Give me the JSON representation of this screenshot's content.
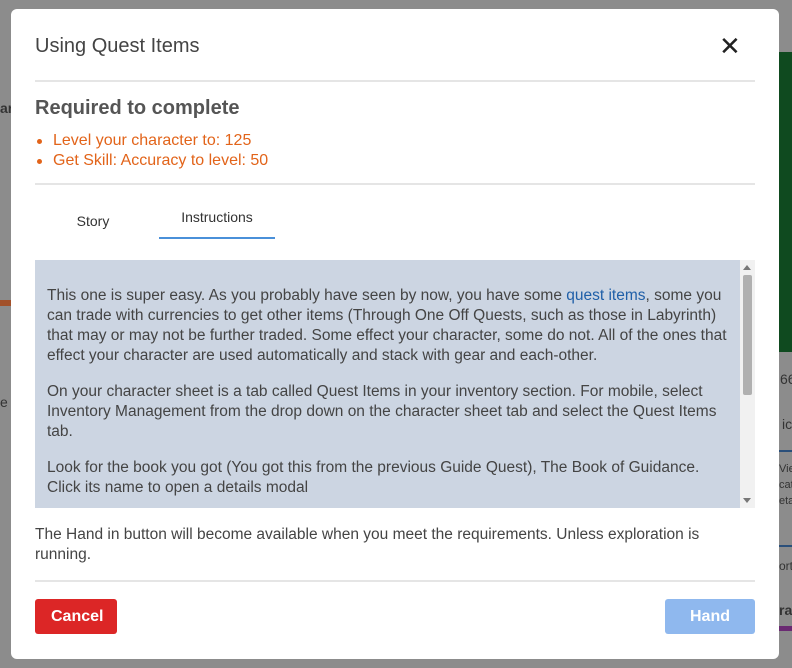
{
  "background": {
    "fragments": [
      "ar",
      "e",
      "66",
      "ict",
      "View",
      "cat",
      "eta",
      "ort",
      "ra"
    ]
  },
  "modal": {
    "title": "Using Quest Items",
    "close_icon": "close-icon"
  },
  "requirements": {
    "heading": "Required to complete",
    "items": [
      "Level your character to: 125",
      "Get Skill: Accuracy to level: 50"
    ],
    "color": "#e2641a"
  },
  "tabs": [
    {
      "label": "Story",
      "active": false
    },
    {
      "label": "Instructions",
      "active": true
    }
  ],
  "instructions": {
    "p1_before_link": "This one is super easy. As you probably have seen by now, you have some ",
    "p1_link": "quest items",
    "p1_after_link": ", some you can trade with currencies to get other items (Through One Off Quests, such as those in Labyrinth) that may or may not be further traded. Some effect your character, some do not. All of the ones that effect your character are used automatically and stack with gear and each-other.",
    "p2": "On your character sheet is a tab called Quest Items in your inventory section. For mobile, select Inventory Management from the drop down on the character sheet tab and select the Quest Items tab.",
    "p3": "Look for the book you got (You got this from the previous Guide Quest), The Book of Guidance. Click its name to open a details modal"
  },
  "footer_note": "The Hand in button will become available when you meet the requirements. Unless exploration is running.",
  "buttons": {
    "cancel": "Cancel",
    "hand_in": "Hand in"
  },
  "colors": {
    "cancel": "#dc2626",
    "hand_in_disabled": "#8fb8ee",
    "instructions_bg": "#ccd5e2",
    "link": "#1f5fa8"
  }
}
